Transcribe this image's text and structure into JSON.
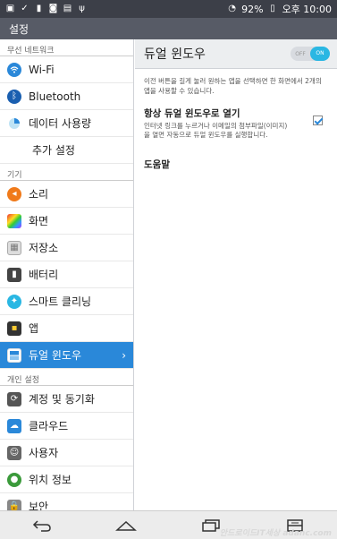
{
  "status_bar": {
    "battery": "92%",
    "time": "오후 10:00"
  },
  "app_bar": {
    "title": "설정"
  },
  "sidebar": {
    "sections": [
      {
        "header": "무선 네트워크",
        "items": [
          {
            "label": "Wi-Fi",
            "icon": "wifi-icon"
          },
          {
            "label": "Bluetooth",
            "icon": "bluetooth-icon"
          },
          {
            "label": "데이터 사용량",
            "icon": "data-usage-icon"
          },
          {
            "label": "추가 설정",
            "icon": ""
          }
        ]
      },
      {
        "header": "기기",
        "items": [
          {
            "label": "소리",
            "icon": "sound-icon"
          },
          {
            "label": "화면",
            "icon": "display-icon"
          },
          {
            "label": "저장소",
            "icon": "storage-icon"
          },
          {
            "label": "배터리",
            "icon": "battery-icon"
          },
          {
            "label": "스마트 클리닝",
            "icon": "smart-cleaning-icon"
          },
          {
            "label": "앱",
            "icon": "apps-icon"
          },
          {
            "label": "듀얼 윈도우",
            "icon": "dual-window-icon",
            "active": true
          }
        ]
      },
      {
        "header": "개인 설정",
        "items": [
          {
            "label": "계정 및 동기화",
            "icon": "accounts-sync-icon"
          },
          {
            "label": "클라우드",
            "icon": "cloud-icon"
          },
          {
            "label": "사용자",
            "icon": "users-icon"
          },
          {
            "label": "위치 정보",
            "icon": "location-icon"
          },
          {
            "label": "보안",
            "icon": "security-icon"
          }
        ]
      }
    ]
  },
  "content": {
    "title": "듀얼 윈도우",
    "toggle": {
      "off_label": "OFF",
      "on_label": "ON",
      "state": "on"
    },
    "description": "이전 버튼을 길게 눌러 원하는 앱을 선택하면 한 화면에서 2개의 앱을 사용할 수 있습니다.",
    "option": {
      "title": "항상 듀얼 윈도우로 열기",
      "subtitle": "인터넷 링크를 누르거나 이메일의 첨부파일(이미지)을 열면 자동으로 듀얼 윈도우를 실행합니다.",
      "checked": true
    },
    "help": "도움말"
  },
  "nav_bar": {
    "buttons": [
      "back-icon",
      "home-icon",
      "recent-apps-icon",
      "menu-icon"
    ]
  },
  "watermark": "안드로이드IT세상 adanc.com",
  "colors": {
    "status_bar": "#3c3f48",
    "app_bar": "#575b66",
    "active_item": "#2a88d9",
    "toggle_on": "#2ab7e3"
  }
}
